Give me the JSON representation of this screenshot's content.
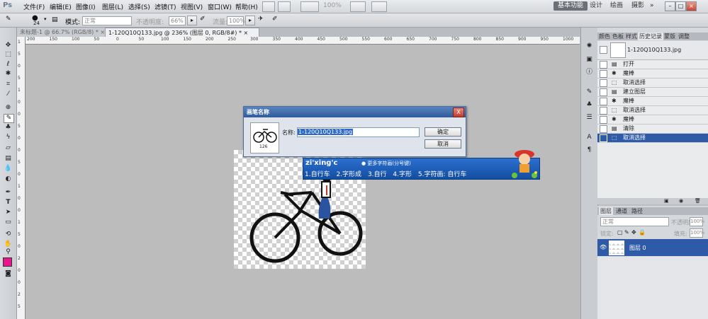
{
  "app": {
    "logo": "Ps"
  },
  "menu": [
    "文件(F)",
    "编辑(E)",
    "图像(I)",
    "图层(L)",
    "选择(S)",
    "滤镜(T)",
    "视图(V)",
    "窗口(W)",
    "帮助(H)"
  ],
  "menubar": {
    "zoom": "100%"
  },
  "workspaces": {
    "active": "基本功能",
    "design": "设计",
    "painting": "绘画",
    "photography": "摄影",
    "more": "»"
  },
  "options": {
    "brush_size": "24",
    "mode_label": "模式:",
    "mode_value": "正常",
    "opacity_label": "不透明度:",
    "opacity_value": "66%",
    "flow_label": "流量:",
    "flow_value": "100%"
  },
  "tabs": [
    {
      "label": "未标题-1 @ 66.7% (RGB/8) *",
      "close": "×"
    },
    {
      "label": "1-120Q10Q133.jpg @ 236% (图层 0, RGB/8#) *",
      "close": "×"
    }
  ],
  "ruler_top": [
    "200",
    "150",
    "100",
    "50",
    "0",
    "50",
    "100",
    "150",
    "200",
    "250",
    "300",
    "350",
    "400",
    "450",
    "500",
    "550",
    "600",
    "650",
    "700",
    "750",
    "800",
    "850",
    "900",
    "950",
    "1000"
  ],
  "ruler_left": [
    "1",
    "5",
    "0",
    "5",
    "1",
    "0",
    "0",
    "5",
    "0",
    "0",
    "5",
    "0",
    "1",
    "0",
    "0",
    "1",
    "5",
    "0",
    "2",
    "0",
    "0",
    "2",
    "5"
  ],
  "dialog": {
    "title": "画笔名称",
    "close": "X",
    "thumb_size": "126",
    "name_label": "名称:",
    "name_value": "1-120Q10Q133.jpg",
    "ok": "确定",
    "cancel": "取消"
  },
  "ime": {
    "input": "zi'xing'c",
    "hint": "更多字符画(分号键)",
    "candidates": [
      "1.自行车",
      "2.字形成",
      "3.自行",
      "4.字形",
      "5.字符画: 自行车"
    ]
  },
  "panels": {
    "tabs": [
      "颜色",
      "色板",
      "样式",
      "历史记录",
      "蒙版",
      "调整"
    ],
    "active_tab": "历史记录",
    "snapshot": "1-120Q10Q133.jpg",
    "history": [
      "打开",
      "魔棒",
      "取消选择",
      "建立图层",
      "魔棒",
      "取消选择",
      "魔棒",
      "清除",
      "取消选择"
    ],
    "history_selected": 8,
    "layer_tabs": [
      "图层",
      "通道",
      "路径"
    ],
    "blend": "正常",
    "opacity_label": "不透明度:",
    "opacity": "100%",
    "lock_label": "锁定:",
    "fill_label": "填充:",
    "fill": "100%",
    "layer_name": "图层 0"
  },
  "colors": {
    "foreground": "#e8168c",
    "selection": "#2e5aa8",
    "dialog_title": "#2f5a9b",
    "ime": "#134ea0"
  }
}
